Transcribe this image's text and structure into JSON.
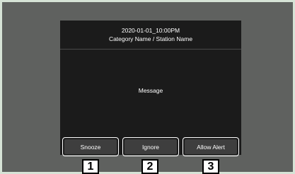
{
  "alert_dialog": {
    "header_line1": "2020-01-01_10:00PM",
    "header_line2": "Category Name / Station Name",
    "message": "Message"
  },
  "buttons": {
    "snooze_label": "Snooze",
    "ignore_label": "Ignore",
    "allow_alert_label": "Allow Alert"
  },
  "callouts": [
    "1",
    "2",
    "3"
  ]
}
